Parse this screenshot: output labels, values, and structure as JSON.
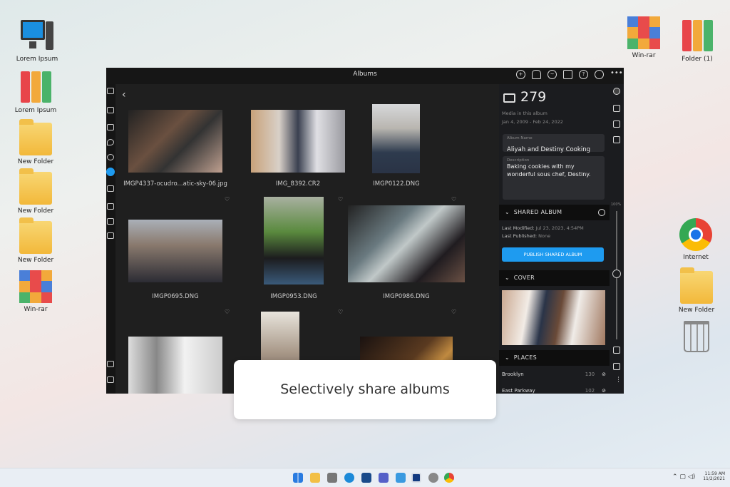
{
  "desktop": {
    "left": [
      {
        "label": "Lorem Ipsum",
        "icon": "computer-icon"
      },
      {
        "label": "Lorem Ipsum",
        "icon": "binder-icon"
      },
      {
        "label": "New Folder",
        "icon": "folder-icon"
      },
      {
        "label": "New Folder",
        "icon": "folder-icon"
      },
      {
        "label": "New Folder",
        "icon": "folder-icon"
      },
      {
        "label": "Win-rar",
        "icon": "winrar-icon"
      }
    ],
    "right": [
      {
        "label": "Win-rar",
        "icon": "winrar-icon"
      },
      {
        "label": "Folder (1)",
        "icon": "binder-icon"
      },
      {
        "label": "Internet",
        "icon": "chrome-icon"
      },
      {
        "label": "New Folder",
        "icon": "folder-icon"
      }
    ]
  },
  "window": {
    "title": "Albums"
  },
  "photos": [
    {
      "name": "IMGP4337-ocudro...atic-sky-06.jpg"
    },
    {
      "name": "IMG_8392.CR2"
    },
    {
      "name": "IMGP0122.DNG"
    },
    {
      "name": "IMGP0695.DNG"
    },
    {
      "name": "IMGP0953.DNG"
    },
    {
      "name": "IMGP0986.DNG"
    }
  ],
  "panel": {
    "count": "279",
    "media_label": "Media in this album",
    "date_range": "Jan 4, 2009 - Feb 24, 2022",
    "album_name_label": "Album Name",
    "album_name": "Aliyah and Destiny Cooking",
    "description_label": "Description",
    "description": "Baking cookies with my wonderful sous chef, Destiny.",
    "shared_header": "SHARED ALBUM",
    "last_modified_label": "Last Modified:",
    "last_modified": "Jul 23, 2023, 4:54PM",
    "last_published_label": "Last Published:",
    "last_published": "None",
    "publish_button": "PUBLISH SHARED ALBUM",
    "cover_header": "COVER",
    "places_header": "PLACES",
    "places": [
      {
        "name": "Brooklyn",
        "count": "130"
      },
      {
        "name": "East Parkway",
        "count": "102"
      }
    ]
  },
  "zoom": "100%",
  "caption": "Selectively share albums",
  "taskbar": {
    "time": "11:59 AM",
    "date": "11/2/2021"
  },
  "colors": {
    "accent": "#1e9bf0"
  }
}
